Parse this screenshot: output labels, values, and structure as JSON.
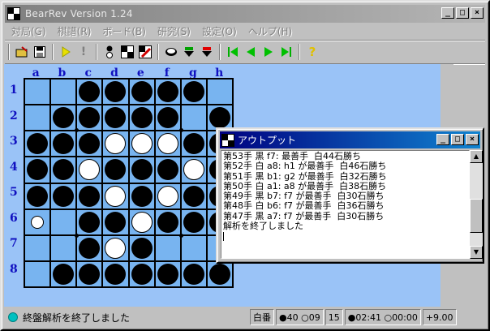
{
  "app": {
    "title": "BearRev  Version 1.24"
  },
  "menu": [
    "対局(G)",
    "棋譜(R)",
    "ボード(B)",
    "研究(S)",
    "設定(O)",
    "ヘルプ(H)"
  ],
  "toolbar_icons": [
    "open-folder-icon",
    "save-icon",
    "play-icon",
    "hint-icon",
    "black-stone-icon",
    "board-icon",
    "edit-board-icon",
    "swap-icon",
    "green-down-icon",
    "red-down-icon",
    "first-icon",
    "prev-icon",
    "next-icon",
    "last-icon",
    "help-icon"
  ],
  "board": {
    "columns": [
      "a",
      "b",
      "c",
      "d",
      "e",
      "f",
      "g",
      "h"
    ],
    "rows": [
      "1",
      "2",
      "3",
      "4",
      "5",
      "6",
      "7",
      "8"
    ],
    "cells": [
      "..BBBBB.",
      ".BBBBB.B",
      "BBBWWWBB",
      "BBWBBBWB",
      "BBBWBWBB",
      "s.BBWBBB",
      "..BWB...",
      ".BBBBBBB"
    ]
  },
  "output": {
    "title": "アウトプット",
    "lines": [
      "第53手 黒 f7: 最善手  白44石勝ち",
      "第52手 白 a8: h1 が最善手  白46石勝ち",
      "第51手 黒 b1: g2 が最善手  白32石勝ち",
      "第50手 白 a1: a8 が最善手  白38石勝ち",
      "第49手 黒 b7: f7 が最善手  白30石勝ち",
      "第48手 白 b6: f7 が最善手  白36石勝ち",
      "第47手 黒 a7: f7 が最善手  白30石勝ち",
      "解析を終了しました"
    ]
  },
  "status": {
    "message": "終盤解析を終了しました",
    "turn": "白番",
    "black_count": "●40",
    "white_count": "○09",
    "move_no": "15",
    "black_time": "●02:41",
    "white_time": "○00:00",
    "eval": "+9.00"
  },
  "colors": {
    "board": "#78b4f0",
    "client": "#9ac3f7",
    "labels": "#1010c0",
    "active_title": "#000080"
  }
}
